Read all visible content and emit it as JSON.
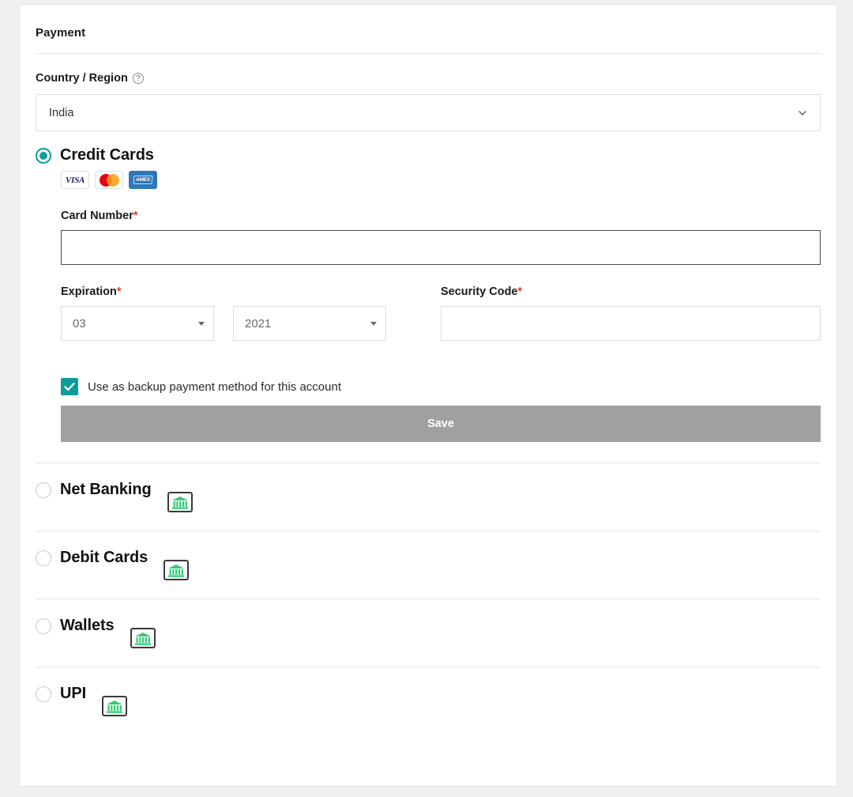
{
  "section": {
    "title": "Payment"
  },
  "country": {
    "label": "Country / Region",
    "help_icon": "help-circle-icon",
    "value": "India",
    "chevron_icon": "chevron-down-icon"
  },
  "credit_cards": {
    "label": "Credit Cards",
    "selected": true,
    "brands": [
      {
        "name": "visa",
        "text": "VISA"
      },
      {
        "name": "mastercard",
        "text": ""
      },
      {
        "name": "amex",
        "text": "AMEX"
      }
    ],
    "card_number": {
      "label": "Card Number",
      "required_mark": "*",
      "value": "",
      "placeholder": ""
    },
    "expiration": {
      "label": "Expiration",
      "required_mark": "*",
      "month": "03",
      "year": "2021"
    },
    "security_code": {
      "label": "Security Code",
      "required_mark": "*",
      "value": "",
      "placeholder": ""
    },
    "backup": {
      "label": "Use as backup payment method for this account",
      "checked": true
    },
    "save_label": "Save"
  },
  "other_methods": [
    {
      "label": "Net Banking",
      "icon": "bank-icon",
      "selected": false
    },
    {
      "label": "Debit Cards",
      "icon": "bank-icon",
      "selected": false
    },
    {
      "label": "Wallets",
      "icon": "bank-icon",
      "selected": false
    },
    {
      "label": "UPI",
      "icon": "bank-icon",
      "selected": false
    }
  ],
  "colors": {
    "accent": "#0f9b9b",
    "required": "#e03b34",
    "save_button": "#a0a0a0",
    "bank_green": "#2ecc71"
  }
}
